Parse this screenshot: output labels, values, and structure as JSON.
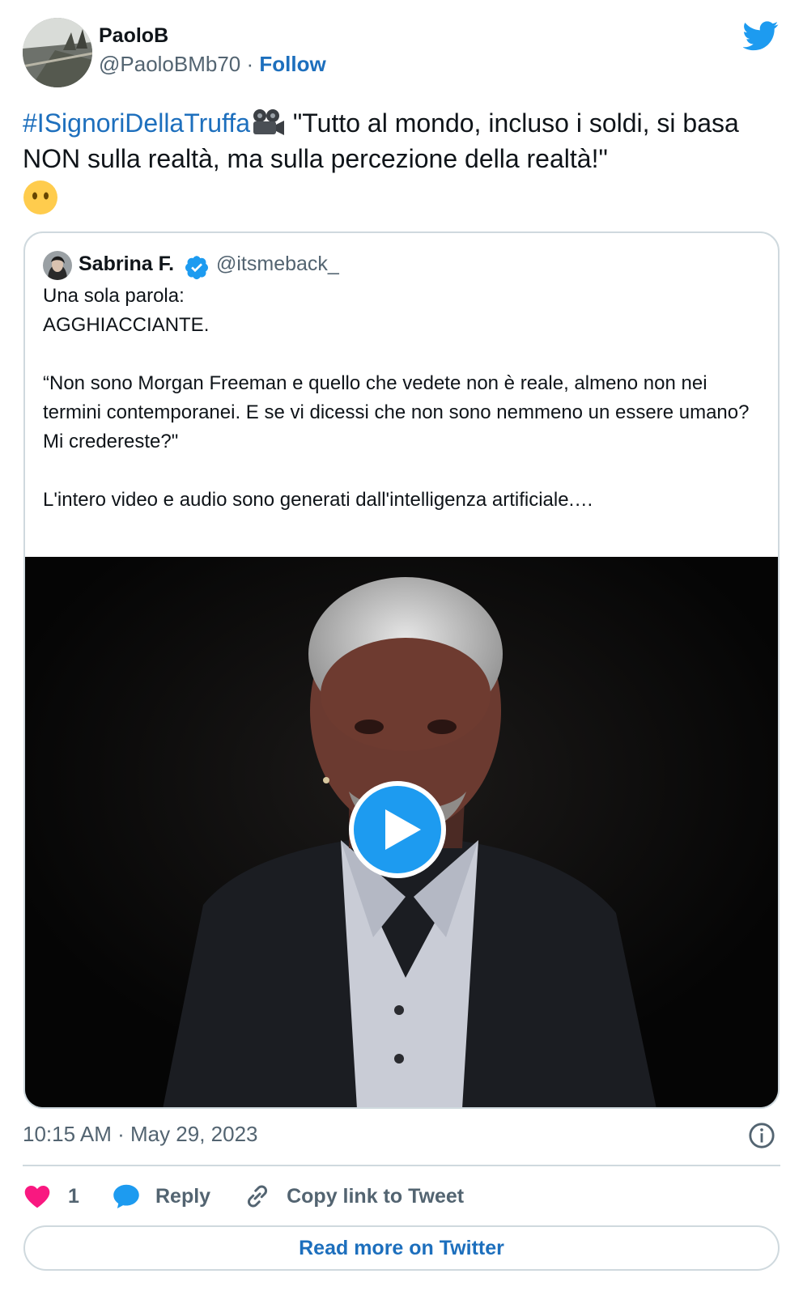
{
  "author": {
    "name": "PaoloB",
    "handle": "@PaoloBMb70",
    "separator": "·",
    "follow_label": "Follow"
  },
  "tweet": {
    "hashtag": "#ISignoriDellaTruffa",
    "text": " \"Tutto al mondo, incluso i soldi, si basa NON sulla realtà, ma sulla percezione della realtà!\" ",
    "emoji_icons": [
      "film-projector-icon",
      "face-without-mouth-icon"
    ]
  },
  "quote": {
    "name": "Sabrina F.",
    "handle": "@itsmeback_",
    "lines": [
      "Una sola parola:",
      "AGGHIACCIANTE.",
      "",
      "“Non sono Morgan Freeman e quello che vedete non è reale, almeno non nei termini contemporanei. E se vi dicessi che non sono nemmeno un essere umano? Mi credereste?\"",
      "",
      "L'intero video e audio sono generati dall'intelligenza artificiale.…"
    ],
    "video": {
      "icon": "play-button-icon"
    }
  },
  "footer": {
    "timestamp": "10:15 AM · May 29, 2023",
    "like_count": "1",
    "reply_label": "Reply",
    "copy_label": "Copy link to Tweet",
    "read_more_label": "Read more on Twitter"
  },
  "colors": {
    "link_blue": "#1d6fbd",
    "twitter_blue": "#1d9bf0",
    "like_pink": "#f91880",
    "muted_text": "#536471",
    "border": "#cfd9de"
  }
}
